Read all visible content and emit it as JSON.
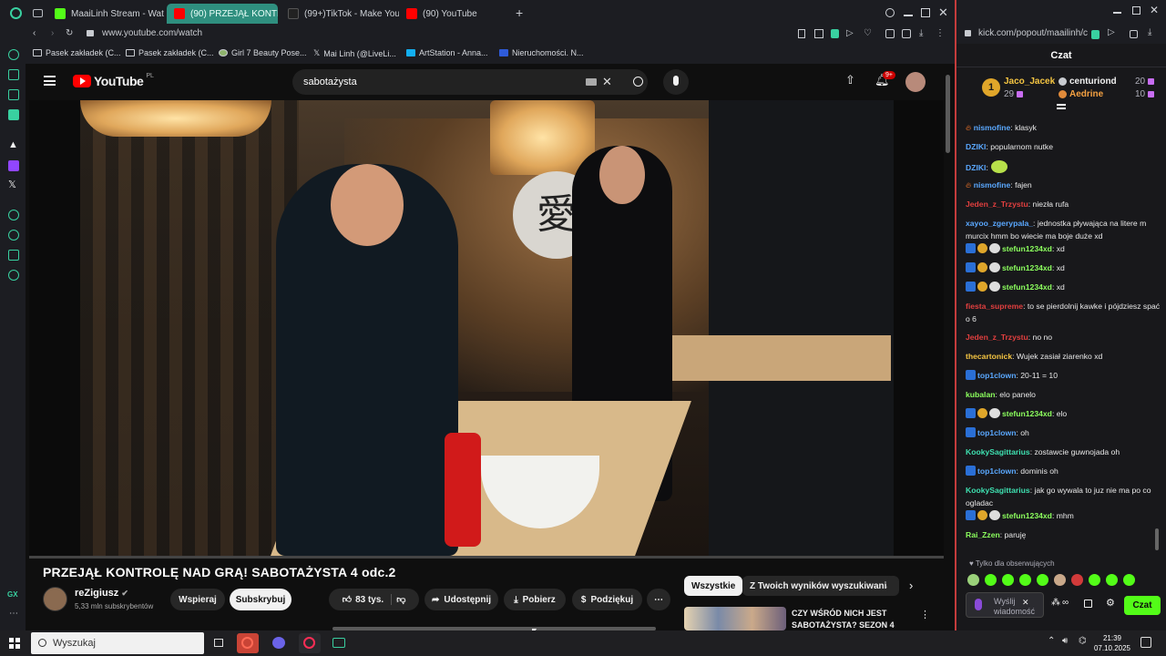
{
  "browser_tabs": [
    {
      "label": "MaaiLinh Stream - Watch",
      "active": false
    },
    {
      "label": "(90) PRZEJĄŁ KONTR",
      "active": true
    },
    {
      "label": "(99+)TikTok - Make Your",
      "active": false
    },
    {
      "label": "(90) YouTube",
      "active": false
    }
  ],
  "address": {
    "url": "www.youtube.com/watch"
  },
  "bookmarks": [
    {
      "label": "Pasek zakładek (C..."
    },
    {
      "label": "Pasek zakładek (C..."
    },
    {
      "label": "Girl 7 Beauty Pose..."
    },
    {
      "label": "Mai Linh (@LiveLi..."
    },
    {
      "label": "ArtStation - Anna..."
    },
    {
      "label": "Nieruchomości. N..."
    }
  ],
  "youtube": {
    "logo_text": "YouTube",
    "logo_region": "PL",
    "search_value": "sabotażysta",
    "notifications_count": "9+",
    "video_title": "PRZEJĄŁ KONTROLĘ NAD GRĄ! SABOTAŻYSTA 4 odc.2",
    "channel_name": "reZigiusz",
    "channel_subs": "5,33 mln subskrybentów",
    "support_label": "Wspieraj",
    "subscribe_label": "Subskrybuj",
    "likes_label": "83 tys.",
    "share_label": "Udostępnij",
    "download_label": "Pobierz",
    "thanks_label": "Podziękuj",
    "video_sign": "愛",
    "chips": [
      {
        "label": "Wszystkie",
        "active": true
      },
      {
        "label": "Z Twoich wyników wyszukiwania",
        "active": false
      }
    ],
    "recommendation_title": "CZY WŚRÓD NICH JEST SABOTAŻYSTA? SEZON 4"
  },
  "chat": {
    "url": "kick.com/popout/maailinh/c",
    "header": "Czat",
    "leaderboard": [
      {
        "rank": "1",
        "name": "Jaco_Jacek",
        "points": "29"
      },
      {
        "name": "centuriond",
        "points": "20"
      },
      {
        "name": "Aedrine",
        "points": "10"
      }
    ],
    "messages": [
      {
        "user": "nismofine",
        "text": ": klasyk",
        "color": "#5aa8ff",
        "badges": []
      },
      {
        "user": "DZIKI",
        "text": ": popularnom nutke",
        "color": "#5aa8ff",
        "badges": []
      },
      {
        "user": "DZIKI",
        "text": ":",
        "color": "#5aa8ff",
        "badges": [],
        "emote": true
      },
      {
        "user": "nismofine",
        "text": ": fajen",
        "color": "#5aa8ff",
        "badges": []
      },
      {
        "user": "Jeden_z_Trzystu",
        "text": ": niezła rufa",
        "color": "#e23f3f",
        "badges": []
      },
      {
        "user": "xayoo_zgerypala_",
        "text": ": jednostka pływająca na litere m murcix hmm bo wiecie ma boje duże xd",
        "color": "#5aa8ff",
        "badges": []
      },
      {
        "user": "stefun1234xd",
        "text": ": xd",
        "color": "#8cff5e",
        "badges": [
          "blue",
          "gold",
          "duo"
        ]
      },
      {
        "user": "stefun1234xd",
        "text": ": xd",
        "color": "#8cff5e",
        "badges": [
          "blue",
          "gold",
          "duo"
        ]
      },
      {
        "user": "stefun1234xd",
        "text": ": xd",
        "color": "#8cff5e",
        "badges": [
          "blue",
          "gold",
          "duo"
        ]
      },
      {
        "user": "fiesta_supreme",
        "text": ": to se pierdolnij kawke i pójdziesz spać o 6",
        "color": "#e23f3f",
        "badges": []
      },
      {
        "user": "Jeden_z_Trzystu",
        "text": ": no no",
        "color": "#e23f3f",
        "badges": []
      },
      {
        "user": "thecartonick",
        "text": ": Wujek zasiał ziarenko xd",
        "color": "#f5c542",
        "badges": []
      },
      {
        "user": "top1clown",
        "text": ": 20-11 = 10",
        "color": "#5aa8ff",
        "badges": [
          "blue"
        ]
      },
      {
        "user": "kubalan",
        "text": ": elo panelo",
        "color": "#8cff5e",
        "badges": []
      },
      {
        "user": "stefun1234xd",
        "text": ": elo",
        "color": "#8cff5e",
        "badges": [
          "blue",
          "gold",
          "duo"
        ]
      },
      {
        "user": "top1clown",
        "text": ": oh",
        "color": "#5aa8ff",
        "badges": [
          "blue"
        ]
      },
      {
        "user": "KookySagittarius",
        "text": ": zostawcie guwnojada oh",
        "color": "#3ee0b0",
        "badges": []
      },
      {
        "user": "top1clown",
        "text": ": dominis oh",
        "color": "#5aa8ff",
        "badges": [
          "blue"
        ]
      },
      {
        "user": "KookySagittarius",
        "text": ": jak go wywala to juz nie ma po co ogladac",
        "color": "#3ee0b0",
        "badges": []
      },
      {
        "user": "stefun1234xd",
        "text": ": mhm",
        "color": "#8cff5e",
        "badges": [
          "blue",
          "gold",
          "duo"
        ]
      },
      {
        "user": "Rai_Zzen",
        "text": ": paruję",
        "color": "#8cff5e",
        "badges": []
      }
    ],
    "followers_only": "Tylko dla obserwujących",
    "input_placeholder": "Wyślij wiadomość",
    "send_label": "Czat"
  },
  "taskbar": {
    "search_placeholder": "Wyszukaj",
    "time": "21:39",
    "date": "07.10.2025"
  },
  "colors": {
    "opera_accent": "#39d0a0",
    "youtube_red": "#ff0000",
    "kick_green": "#53fc18",
    "active_tab": "#2f8f7f"
  }
}
